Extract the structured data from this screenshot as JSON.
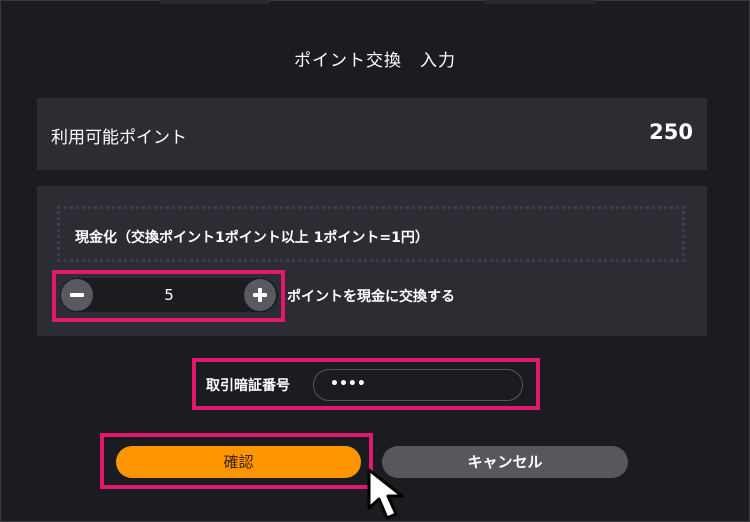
{
  "dialog": {
    "title": "ポイント交換　入力",
    "available": {
      "label": "利用可能ポイント",
      "value": "250"
    },
    "exchange": {
      "description": "現金化（交換ポイント1ポイント以上 1ポイント=1円）",
      "amount": "5",
      "suffix": "ポイントを現金に交換する"
    },
    "pin": {
      "label": "取引暗証番号",
      "value": "••••"
    },
    "buttons": {
      "confirm": "確認",
      "cancel": "キャンセル"
    }
  },
  "colors": {
    "accent": "#ff9500",
    "highlight": "#e2186f",
    "panel": "#2b2d33",
    "background": "#1b1c1f"
  },
  "icons": {
    "decrement": "minus-icon",
    "increment": "plus-icon",
    "pointer": "mouse-cursor-icon"
  }
}
